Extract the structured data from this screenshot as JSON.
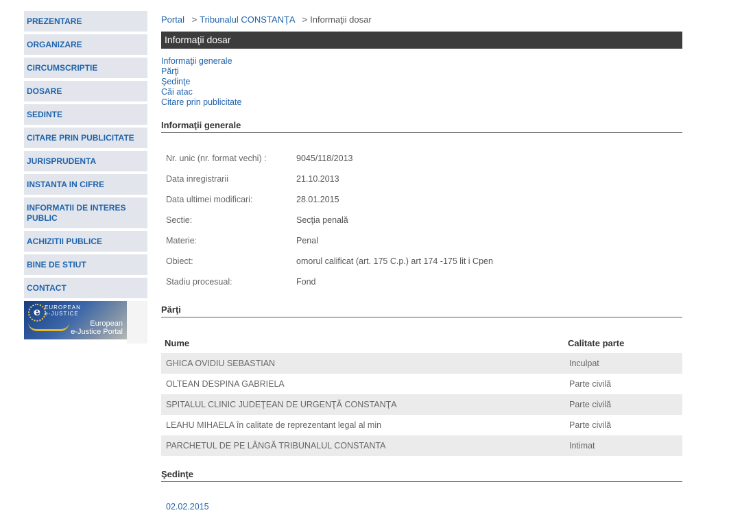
{
  "sidebar": {
    "items": [
      {
        "label": "PREZENTARE"
      },
      {
        "label": "ORGANIZARE"
      },
      {
        "label": "CIRCUMSCRIPTIE"
      },
      {
        "label": "DOSARE"
      },
      {
        "label": "SEDINTE"
      },
      {
        "label": "CITARE PRIN PUBLICITATE"
      },
      {
        "label": "JURISPRUDENTA"
      },
      {
        "label": "INSTANTA IN CIFRE"
      },
      {
        "label": "INFORMATII DE INTERES PUBLIC"
      },
      {
        "label": "ACHIZITII PUBLICE"
      },
      {
        "label": "BINE DE STIUT"
      },
      {
        "label": "CONTACT"
      }
    ],
    "banner": {
      "top_text": "EUROPEAN e-JUSTICE",
      "label_line1": "European",
      "label_line2": "e-Justice Portal",
      "icon": "e-justice-logo"
    }
  },
  "breadcrumb": {
    "home": "Portal",
    "court": "Tribunalul CONSTANŢA",
    "current": "Informaţii dosar",
    "separator": ">"
  },
  "page_title": "Informaţii dosar",
  "anchors": [
    "Informaţii generale",
    "Părţi",
    "Şedinţe",
    "Căi atac",
    "Citare prin publicitate"
  ],
  "general": {
    "heading": "Informaţii generale",
    "rows": [
      {
        "label": "Nr. unic (nr. format vechi) :",
        "value": "9045/118/2013"
      },
      {
        "label": "Data inregistrarii",
        "value": "21.10.2013"
      },
      {
        "label": "Data ultimei modificari:",
        "value": "28.01.2015"
      },
      {
        "label": "Sectie:",
        "value": "Secţia penală"
      },
      {
        "label": "Materie:",
        "value": "Penal"
      },
      {
        "label": "Obiect:",
        "value": "omorul calificat (art. 175 C.p.) art 174 -175 lit i Cpen"
      },
      {
        "label": "Stadiu procesual:",
        "value": "Fond"
      }
    ]
  },
  "parties": {
    "heading": "Părţi",
    "columns": [
      "Nume",
      "Calitate parte"
    ],
    "rows": [
      {
        "name": "GHICA OVIDIU SEBASTIAN",
        "role": "Inculpat"
      },
      {
        "name": "OLTEAN DESPINA GABRIELA",
        "role": "Parte civilă"
      },
      {
        "name": "SPITALUL CLINIC JUDEŢEAN DE URGENŢĂ CONSTANŢA",
        "role": "Parte civilă"
      },
      {
        "name": "LEAHU MIHAELA în calitate de reprezentant legal al min",
        "role": "Parte civilă"
      },
      {
        "name": "PARCHETUL DE PE LÂNGĂ TRIBUNALUL CONSTANTA",
        "role": "Intimat"
      }
    ]
  },
  "hearings": {
    "heading": "Şedinţe",
    "dates": [
      "02.02.2015"
    ]
  },
  "colors": {
    "link": "#1f63ad",
    "nav_bg": "#e2e6ec",
    "title_bar": "#3c3c3c",
    "row_alt": "#ebebeb"
  }
}
